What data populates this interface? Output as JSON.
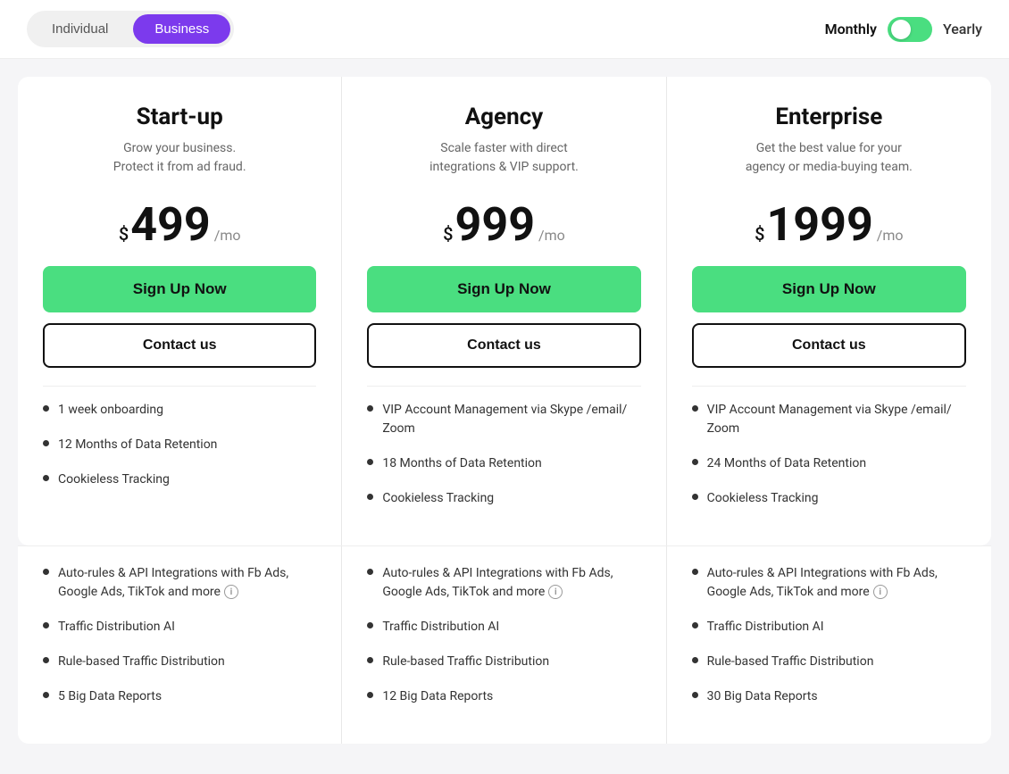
{
  "topBar": {
    "planToggle": {
      "individual": "Individual",
      "business": "Business",
      "activeTab": "business"
    },
    "billingToggle": {
      "monthly": "Monthly",
      "yearly": "Yearly",
      "active": "monthly"
    }
  },
  "plans": [
    {
      "id": "startup",
      "name": "Start-up",
      "description": "Grow your business.\nProtect it from ad fraud.",
      "price": "499",
      "pricePeriod": "/mo",
      "priceDollar": "$",
      "signupLabel": "Sign Up Now",
      "contactLabel": "Contact us",
      "features": [
        "1 week onboarding",
        "12 Months of Data Retention",
        "Cookieless Tracking"
      ],
      "bottomFeatures": [
        {
          "text": "Auto-rules & API Integrations with Fb Ads, Google Ads, TikTok and more",
          "hasInfo": true
        },
        {
          "text": "Traffic Distribution AI",
          "hasInfo": false
        },
        {
          "text": "Rule-based Traffic Distribution",
          "hasInfo": false
        },
        {
          "text": "5 Big Data Reports",
          "hasInfo": false
        }
      ]
    },
    {
      "id": "agency",
      "name": "Agency",
      "description": "Scale faster with direct\nintegrations & VIP support.",
      "price": "999",
      "pricePeriod": "/mo",
      "priceDollar": "$",
      "signupLabel": "Sign Up Now",
      "contactLabel": "Contact us",
      "features": [
        "VIP Account Management via Skype /email/ Zoom",
        "18 Months of Data Retention",
        "Cookieless Tracking"
      ],
      "bottomFeatures": [
        {
          "text": "Auto-rules & API Integrations with Fb Ads, Google Ads, TikTok and more",
          "hasInfo": true
        },
        {
          "text": "Traffic Distribution AI",
          "hasInfo": false
        },
        {
          "text": "Rule-based Traffic Distribution",
          "hasInfo": false
        },
        {
          "text": "12 Big Data Reports",
          "hasInfo": false
        }
      ]
    },
    {
      "id": "enterprise",
      "name": "Enterprise",
      "description": "Get the best value for your\nagency or media-buying team.",
      "price": "1999",
      "pricePeriod": "/mo",
      "priceDollar": "$",
      "signupLabel": "Sign Up Now",
      "contactLabel": "Contact us",
      "features": [
        "VIP Account Management via Skype /email/ Zoom",
        "24 Months of Data Retention",
        "Cookieless Tracking"
      ],
      "bottomFeatures": [
        {
          "text": "Auto-rules & API Integrations with Fb Ads, Google Ads, TikTok and more",
          "hasInfo": true
        },
        {
          "text": "Traffic Distribution AI",
          "hasInfo": false
        },
        {
          "text": "Rule-based Traffic Distribution",
          "hasInfo": false
        },
        {
          "text": "30 Big Data Reports",
          "hasInfo": false
        }
      ]
    }
  ]
}
